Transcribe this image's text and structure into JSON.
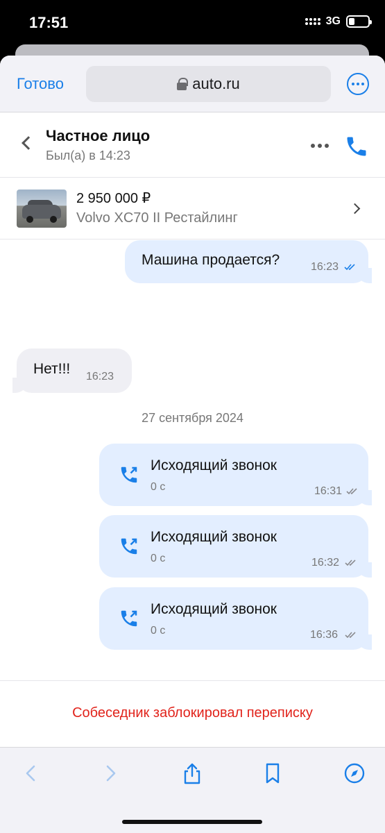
{
  "status_bar": {
    "time": "17:51",
    "network": "3G"
  },
  "browser": {
    "done_label": "Готово",
    "url": "auto.ru"
  },
  "chat_header": {
    "name": "Частное лицо",
    "status": "Был(а) в 14:23"
  },
  "listing": {
    "price": "2 950 000 ₽",
    "model": "Volvo XC70 II Рестайлинг"
  },
  "messages": [
    {
      "direction": "outgoing",
      "text": "Машина продается?",
      "time": "16:23",
      "status": "read"
    },
    {
      "direction": "incoming",
      "text": "Нет!!!",
      "time": "16:23"
    }
  ],
  "date_separator": "27 сентября 2024",
  "calls": [
    {
      "title": "Исходящий звонок",
      "duration": "0 с",
      "time": "16:31",
      "status": "sent"
    },
    {
      "title": "Исходящий звонок",
      "duration": "0 с",
      "time": "16:32",
      "status": "sent"
    },
    {
      "title": "Исходящий звонок",
      "duration": "0 с",
      "time": "16:36",
      "status": "sent"
    }
  ],
  "blocked_notice": "Собеседник заблокировал переписку",
  "colors": {
    "accent": "#1a7fe8",
    "outgoing_bubble": "#e3eeff",
    "incoming_bubble": "#efeff4",
    "alert": "#e1231b"
  },
  "icons": [
    "back-chevron",
    "phone",
    "more",
    "share",
    "bookmark",
    "compass"
  ]
}
